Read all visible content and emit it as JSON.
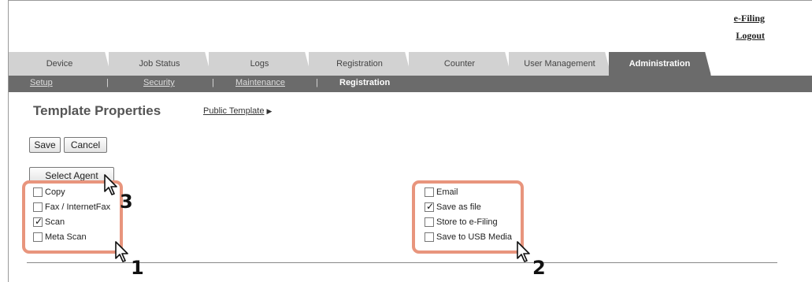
{
  "header": {
    "links": [
      {
        "label": "e-Filing"
      },
      {
        "label": "Logout"
      }
    ]
  },
  "tabs": [
    {
      "label": "Device"
    },
    {
      "label": "Job Status"
    },
    {
      "label": "Logs"
    },
    {
      "label": "Registration"
    },
    {
      "label": "Counter"
    },
    {
      "label": "User Management"
    },
    {
      "label": "Administration",
      "active": true
    }
  ],
  "subnav": [
    {
      "label": "Setup"
    },
    {
      "label": "Security"
    },
    {
      "label": "Maintenance"
    },
    {
      "label": "Registration",
      "active": true
    }
  ],
  "page": {
    "title": "Template Properties",
    "public_template_link": "Public Template",
    "save_label": "Save",
    "cancel_label": "Cancel",
    "select_agent_label": "Select Agent"
  },
  "agents_left": [
    {
      "label": "Copy",
      "checked": false
    },
    {
      "label": "Fax / InternetFax",
      "checked": false
    },
    {
      "label": "Scan",
      "checked": true
    },
    {
      "label": "Meta Scan",
      "checked": false
    }
  ],
  "agents_right": [
    {
      "label": "Email",
      "checked": false
    },
    {
      "label": "Save as file",
      "checked": true
    },
    {
      "label": "Store to e-Filing",
      "checked": false
    },
    {
      "label": "Save to USB Media",
      "checked": false
    }
  ],
  "steps": [
    "1",
    "2",
    "3"
  ],
  "colors": {
    "highlight": "#e8957d",
    "tab_active": "#6b6b6b",
    "tab_inactive": "#d2d2d2"
  },
  "icons": {
    "pointer": "mouse-pointer-icon",
    "arrow": "right-triangle-icon"
  }
}
